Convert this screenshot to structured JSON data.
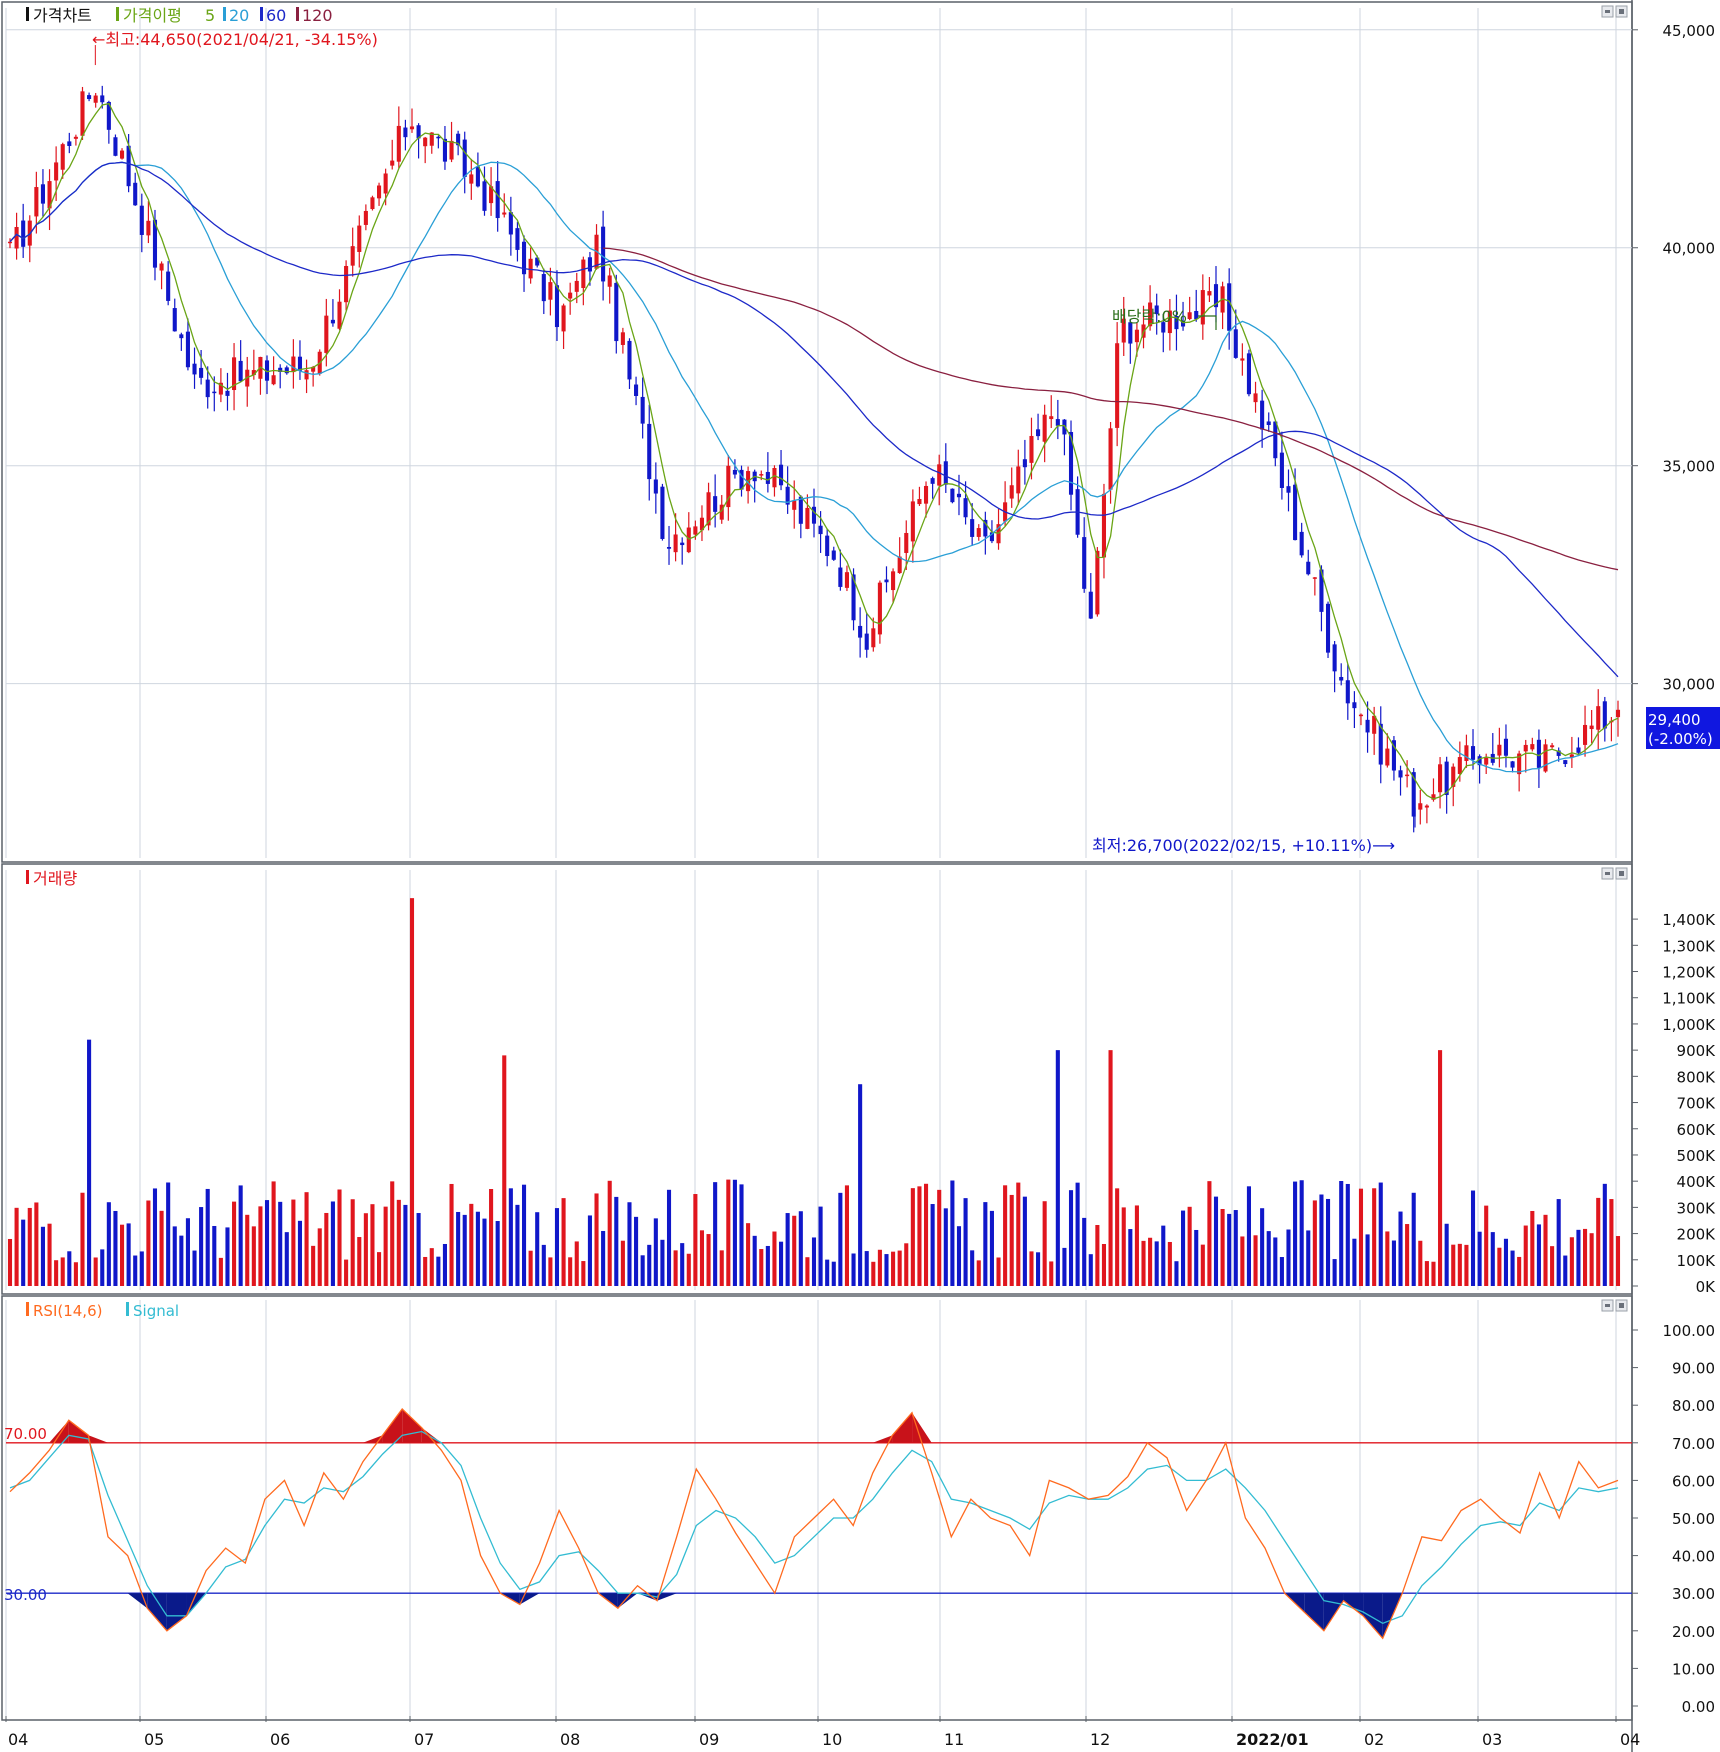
{
  "colors": {
    "up": "#e0161e",
    "down": "#1017c9",
    "ma5": "#6aa516",
    "ma20": "#2a9fd6",
    "ma60": "#1d29c8",
    "ma120": "#8a2040",
    "rsi": "#ff6a1f",
    "signal": "#33bcd2",
    "grid": "#cfd6df",
    "current_bg": "#1017e0"
  },
  "price_panel": {
    "title": "가격차트",
    "legend_label": "가격이평",
    "legend_periods": [
      "5",
      "20",
      "60",
      "120"
    ],
    "high_annotation": "←최고:44,650(2021/04/21, -34.15%)",
    "low_annotation": "최저:26,700(2022/02/15, +10.11%)⟶",
    "dividend_annotation": "배당락:0%",
    "current_price": "29,400",
    "current_change": "(-2.00%)",
    "y_ticks": [
      "45,000",
      "40,000",
      "35,000",
      "30,000"
    ]
  },
  "volume_panel": {
    "title": "거래량",
    "y_ticks": [
      "1,400K",
      "1,300K",
      "1,200K",
      "1,100K",
      "1,000K",
      "900K",
      "800K",
      "700K",
      "600K",
      "500K",
      "400K",
      "300K",
      "200K",
      "100K",
      "0K"
    ]
  },
  "rsi_panel": {
    "title": "RSI(14,6)",
    "signal_label": "Signal",
    "upper_level_label": "70.00",
    "lower_level_label": "30.00",
    "y_ticks": [
      "100.00",
      "90.00",
      "80.00",
      "70.00",
      "60.00",
      "50.00",
      "40.00",
      "30.00",
      "20.00",
      "10.00",
      "0.00"
    ]
  },
  "x_axis": {
    "labels": [
      "04",
      "05",
      "06",
      "07",
      "08",
      "09",
      "10",
      "11",
      "12",
      "2022/01",
      "02",
      "03",
      "04"
    ]
  },
  "chart_data": [
    {
      "type": "candlestick",
      "title": "가격차트",
      "x_range": [
        "2021/04",
        "2022/04"
      ],
      "ylim": [
        26000,
        45500
      ],
      "high": {
        "value": 44650,
        "date": "2021/04/21",
        "change_pct": -34.15
      },
      "low": {
        "value": 26700,
        "date": "2022/02/15",
        "change_pct": 10.11
      },
      "last_close": 29400,
      "last_change_pct": -2.0,
      "moving_averages": [
        5,
        20,
        60,
        120
      ],
      "key_closes": [
        {
          "date": "2021/04/01",
          "close": 39600
        },
        {
          "date": "2021/04/21",
          "close": 43800
        },
        {
          "date": "2021/05/04",
          "close": 40000
        },
        {
          "date": "2021/05/14",
          "close": 36900
        },
        {
          "date": "2021/06/10",
          "close": 37300
        },
        {
          "date": "2021/07/01",
          "close": 43000
        },
        {
          "date": "2021/07/15",
          "close": 41500
        },
        {
          "date": "2021/08/02",
          "close": 38400
        },
        {
          "date": "2021/08/10",
          "close": 40100
        },
        {
          "date": "2021/08/25",
          "close": 33300
        },
        {
          "date": "2021/09/15",
          "close": 35100
        },
        {
          "date": "2021/10/05",
          "close": 33000
        },
        {
          "date": "2021/10/13",
          "close": 31100
        },
        {
          "date": "2021/10/29",
          "close": 35000
        },
        {
          "date": "2021/11/10",
          "close": 33000
        },
        {
          "date": "2021/11/25",
          "close": 36500
        },
        {
          "date": "2021/12/02",
          "close": 31300
        },
        {
          "date": "2021/12/08",
          "close": 38200
        },
        {
          "date": "2021/12/29",
          "close": 38700
        },
        {
          "date": "2022/01/10",
          "close": 35500
        },
        {
          "date": "2022/01/27",
          "close": 30000
        },
        {
          "date": "2022/02/15",
          "close": 27300
        },
        {
          "date": "2022/03/03",
          "close": 28500
        },
        {
          "date": "2022/03/15",
          "close": 28200
        },
        {
          "date": "2022/03/31",
          "close": 29400
        }
      ]
    },
    {
      "type": "bar",
      "title": "거래량",
      "ylabel_unit": "K",
      "ylim": [
        0,
        1450
      ],
      "notable_peaks": [
        {
          "date": "2021/04/20",
          "value": 940
        },
        {
          "date": "2021/07/01",
          "value": 1480
        },
        {
          "date": "2021/07/20",
          "value": 880
        },
        {
          "date": "2021/10/12",
          "value": 770
        },
        {
          "date": "2021/11/25",
          "value": 900
        },
        {
          "date": "2021/12/06",
          "value": 900
        },
        {
          "date": "2022/02/22",
          "value": 900
        }
      ]
    },
    {
      "type": "line",
      "title": "RSI(14,6)",
      "ylim": [
        0,
        100
      ],
      "reference_levels": [
        70,
        30
      ],
      "series": [
        {
          "name": "RSI(14,6)",
          "values": [
            57,
            62,
            68,
            76,
            72,
            45,
            40,
            26,
            20,
            24,
            36,
            42,
            38,
            55,
            60,
            48,
            62,
            55,
            65,
            72,
            79,
            74,
            68,
            60,
            40,
            30,
            27,
            38,
            52,
            42,
            30,
            26,
            32,
            28,
            45,
            63,
            55,
            46,
            38,
            30,
            45,
            50,
            55,
            48,
            62,
            72,
            78,
            62,
            45,
            55,
            50,
            48,
            40,
            60,
            58,
            55,
            56,
            61,
            70,
            66,
            52,
            60,
            70,
            50,
            42,
            30,
            25,
            20,
            28,
            24,
            18,
            30,
            45,
            44,
            52,
            55,
            50,
            46,
            62,
            50,
            65,
            58,
            60
          ]
        },
        {
          "name": "Signal",
          "values": [
            58,
            60,
            66,
            72,
            71,
            56,
            44,
            32,
            24,
            24,
            30,
            37,
            39,
            48,
            55,
            54,
            58,
            57,
            61,
            67,
            72,
            73,
            70,
            64,
            50,
            38,
            31,
            33,
            40,
            41,
            36,
            30,
            30,
            29,
            35,
            48,
            52,
            50,
            45,
            38,
            40,
            45,
            50,
            50,
            55,
            62,
            68,
            65,
            55,
            54,
            52,
            50,
            47,
            54,
            56,
            55,
            55,
            58,
            63,
            64,
            60,
            60,
            63,
            58,
            52,
            44,
            36,
            28,
            27,
            25,
            22,
            24,
            32,
            37,
            43,
            48,
            49,
            48,
            54,
            52,
            58,
            57,
            58
          ]
        }
      ]
    }
  ]
}
